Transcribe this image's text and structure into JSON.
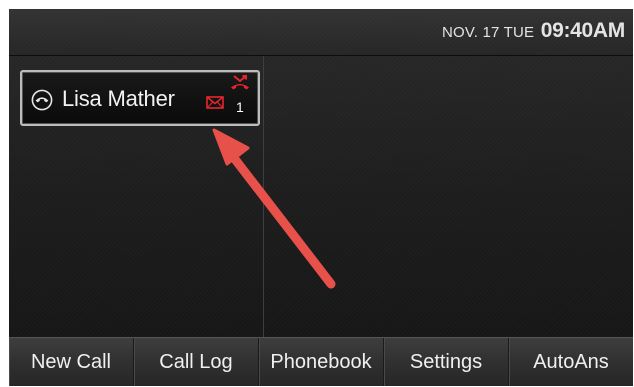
{
  "status_bar": {
    "date": "NOV. 17 TUE",
    "time": "09:40AM"
  },
  "line_key": {
    "name": "Lisa Mather",
    "missed_calls": "1",
    "icons": {
      "line_status": "handset-icon",
      "message": "mail-icon",
      "missed_call": "missed-call-icon"
    }
  },
  "softkeys": [
    {
      "label": "New Call"
    },
    {
      "label": "Call Log"
    },
    {
      "label": "Phonebook"
    },
    {
      "label": "Settings"
    },
    {
      "label": "AutoAns"
    }
  ],
  "colors": {
    "alert_red": "#e8262b",
    "annotation_arrow": "#e8514a"
  }
}
